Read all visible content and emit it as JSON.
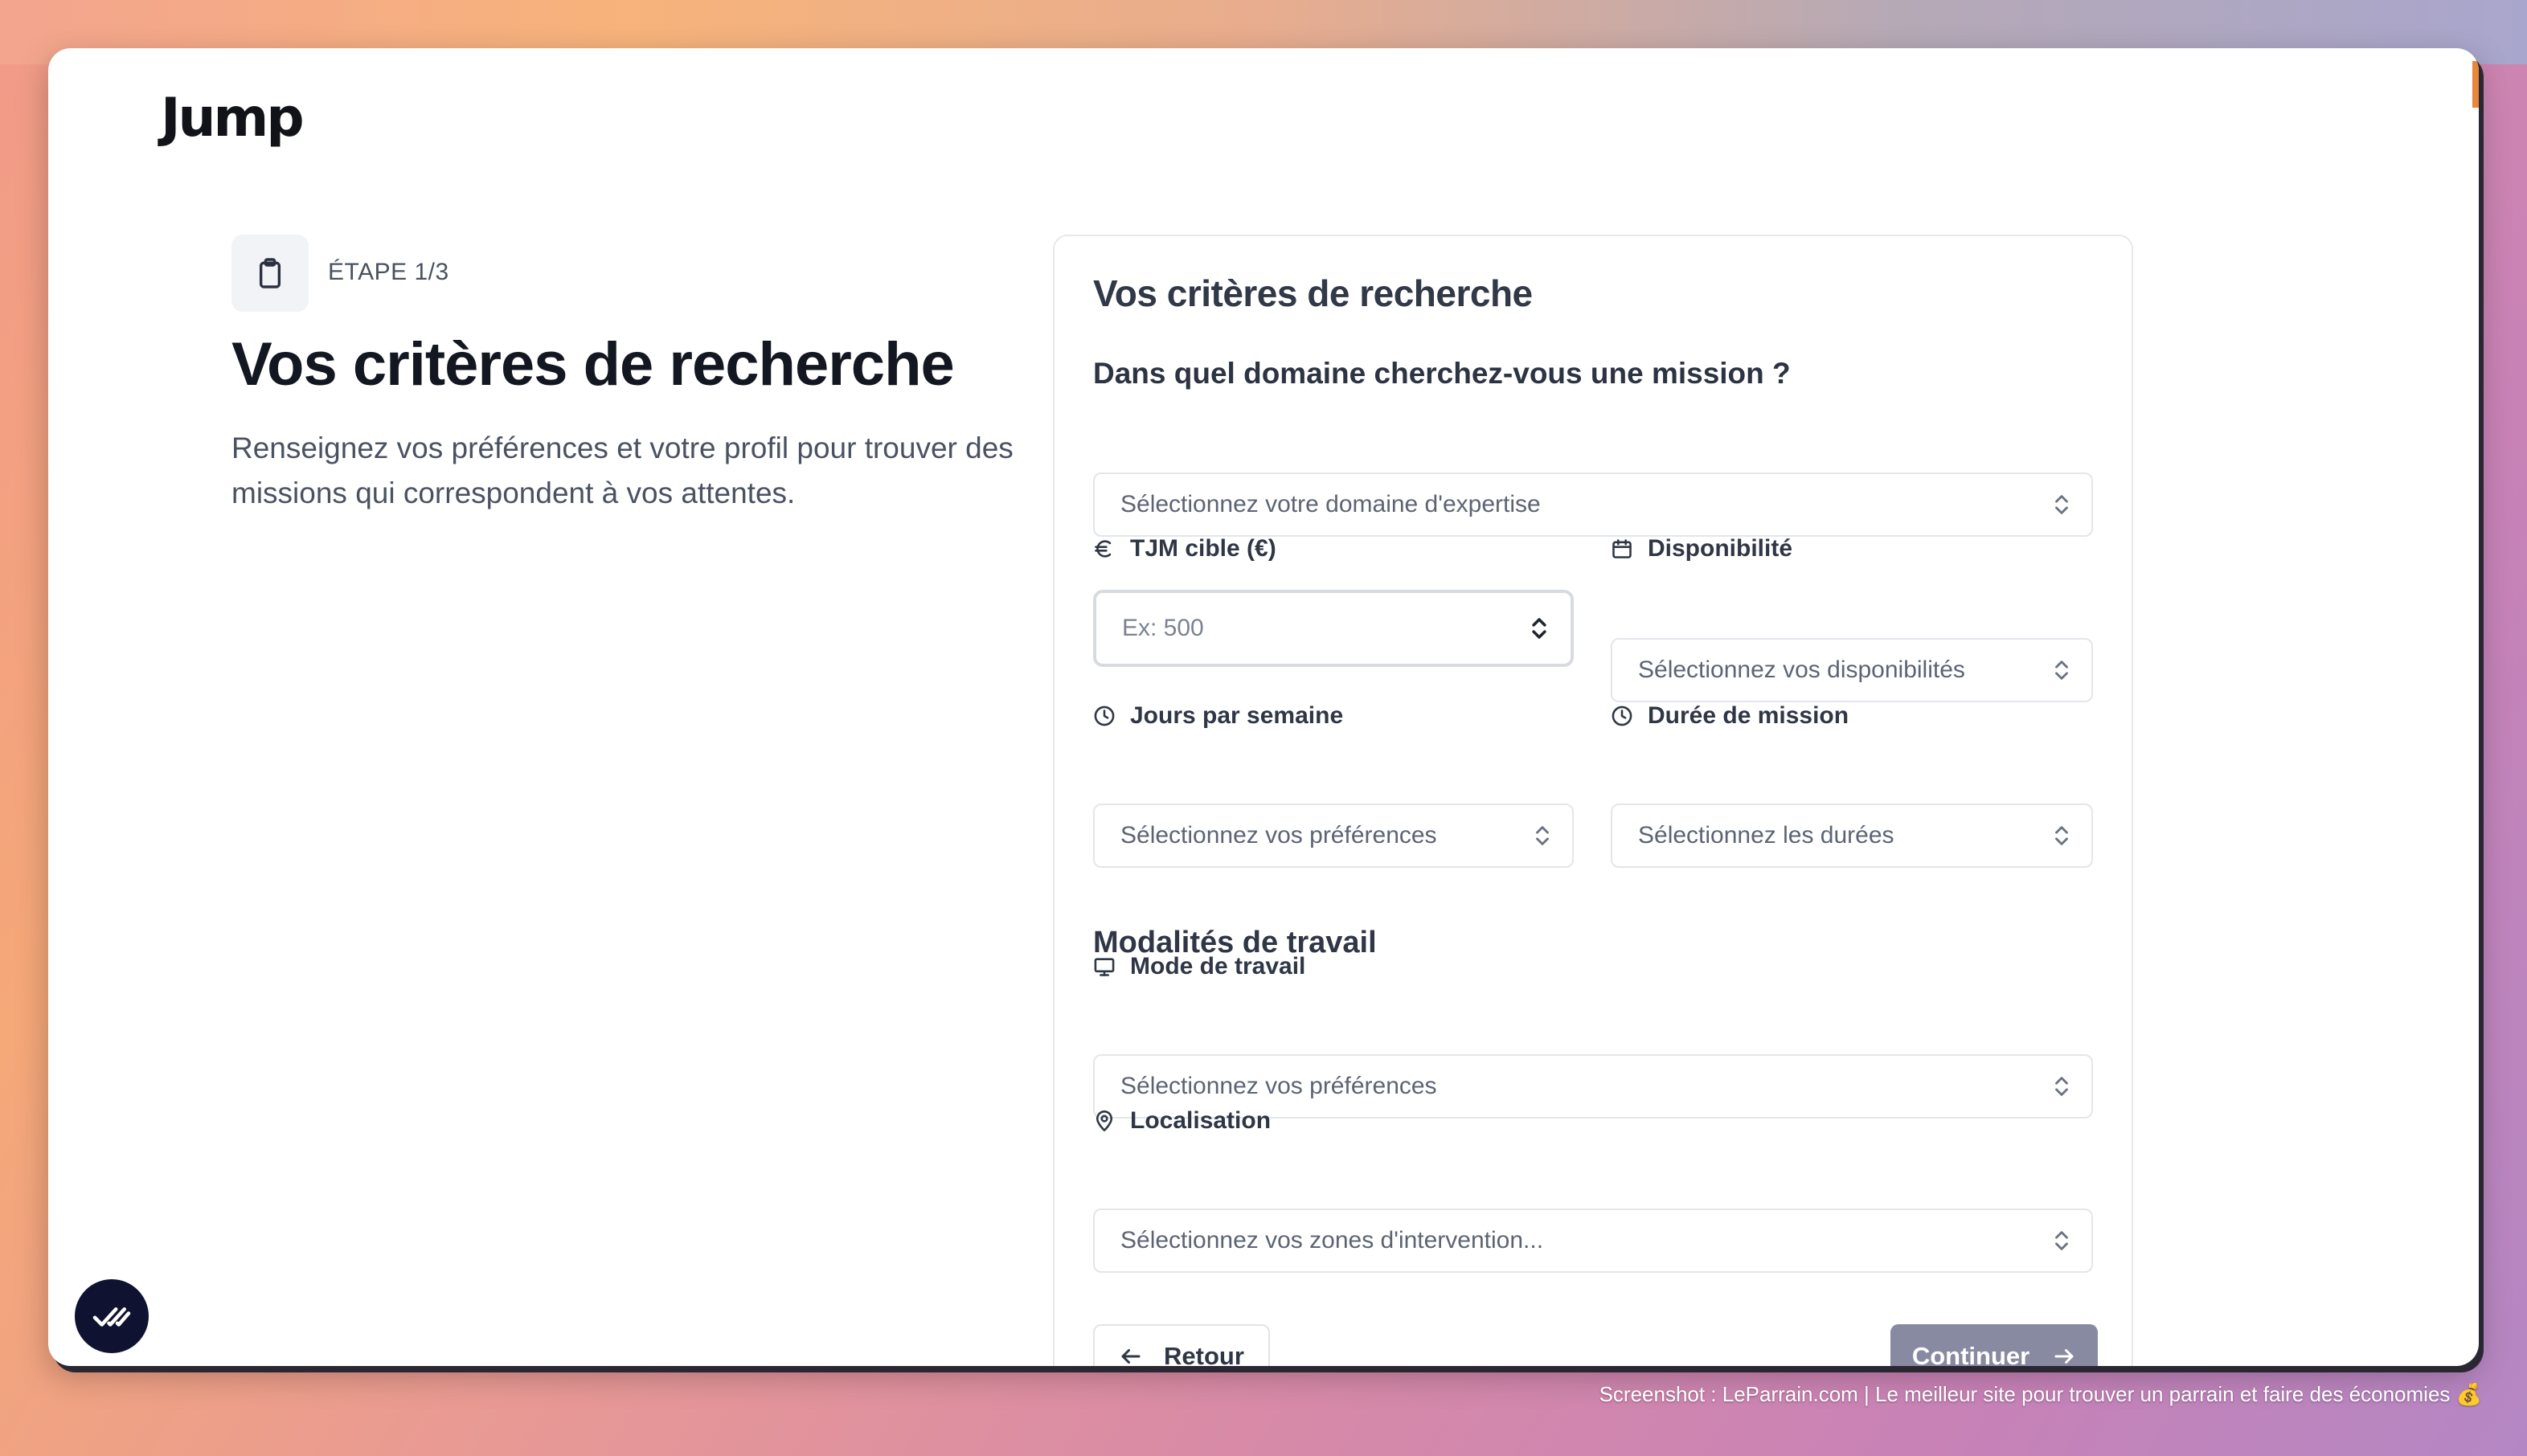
{
  "app": {
    "logo_text": "Jump"
  },
  "step": {
    "label": "ÉTAPE 1/3"
  },
  "hero": {
    "title": "Vos critères de recherche",
    "description": "Renseignez vos préférences et votre profil pour trouver des missions qui correspondent à vos attentes."
  },
  "form": {
    "title": "Vos critères de recherche",
    "domain_question": "Dans quel domaine cherchez-vous une mission ?",
    "domain_select": "Sélectionnez votre domaine d'expertise",
    "tjm_label": "TJM cible (€)",
    "tjm_placeholder": "Ex: 500",
    "availability_label": "Disponibilité",
    "availability_select": "Sélectionnez vos disponibilités",
    "days_label": "Jours par semaine",
    "days_select": "Sélectionnez vos préférences",
    "duration_label": "Durée de mission",
    "duration_select": "Sélectionnez les durées",
    "work_section_title": "Modalités de travail",
    "work_mode_label": "Mode de travail",
    "work_mode_select": "Sélectionnez vos préférences",
    "location_label": "Localisation",
    "location_select": "Sélectionnez vos zones d'intervention...",
    "back_button": "Retour",
    "continue_button": "Continuer"
  },
  "footer": {
    "note": "Screenshot : LeParrain.com | Le meilleur site pour trouver un parrain et faire des économies 💰"
  },
  "colors": {
    "primary_button": "#888aa1",
    "heading": "#121722",
    "fab": "#0f1230"
  }
}
